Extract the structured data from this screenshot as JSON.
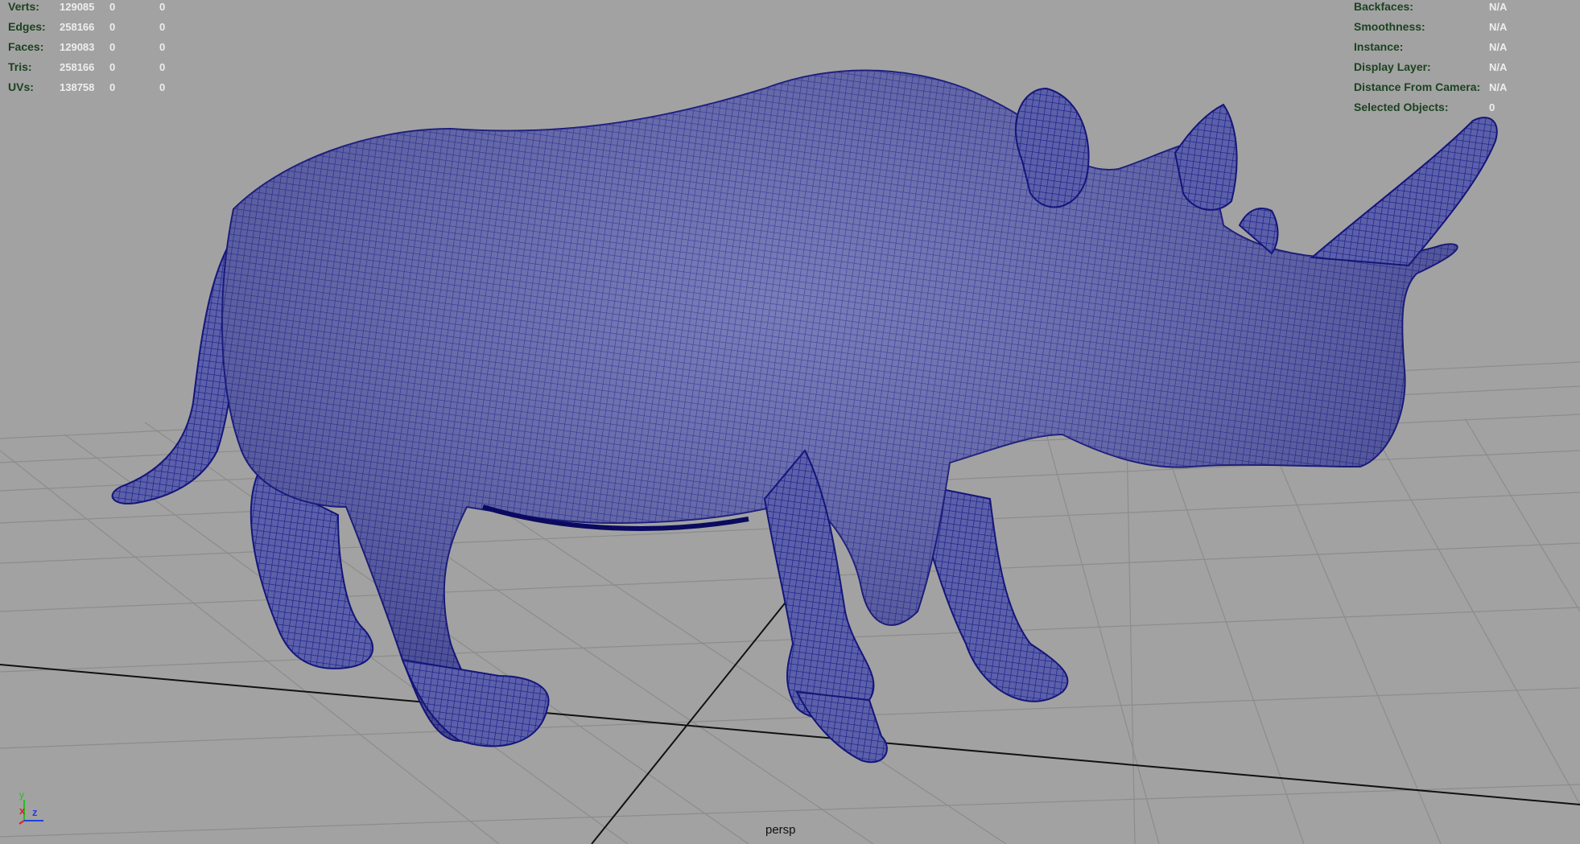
{
  "mesh_stats": [
    {
      "label": "Verts:",
      "values": [
        "129085",
        "0",
        "0"
      ]
    },
    {
      "label": "Edges:",
      "values": [
        "258166",
        "0",
        "0"
      ]
    },
    {
      "label": "Faces:",
      "values": [
        "129083",
        "0",
        "0"
      ]
    },
    {
      "label": "Tris:",
      "values": [
        "258166",
        "0",
        "0"
      ]
    },
    {
      "label": "UVs:",
      "values": [
        "138758",
        "0",
        "0"
      ]
    }
  ],
  "object_info": [
    {
      "label": "Backfaces:",
      "value": "N/A"
    },
    {
      "label": "Smoothness:",
      "value": "N/A"
    },
    {
      "label": "Instance:",
      "value": "N/A"
    },
    {
      "label": "Display Layer:",
      "value": "N/A"
    },
    {
      "label": "Distance From Camera:",
      "value": "N/A"
    },
    {
      "label": "Selected Objects:",
      "value": "0"
    }
  ],
  "viewport": {
    "camera_name": "persp",
    "model": "rhinoceros",
    "shading": "wireframe-on-shaded"
  },
  "axes": {
    "y": "y",
    "x": "x",
    "z": "z"
  },
  "colors": {
    "background": "#a2a2a2",
    "grid": "#8b8b8b",
    "grid_axis": "#111111",
    "mesh_fill": "#5b5fa6",
    "mesh_wire": "#1a1a8e",
    "hud_label": "#1c4220",
    "hud_value": "#eeeeee",
    "axis_x": "#e02020",
    "axis_y": "#20c020",
    "axis_z": "#2040e0"
  }
}
